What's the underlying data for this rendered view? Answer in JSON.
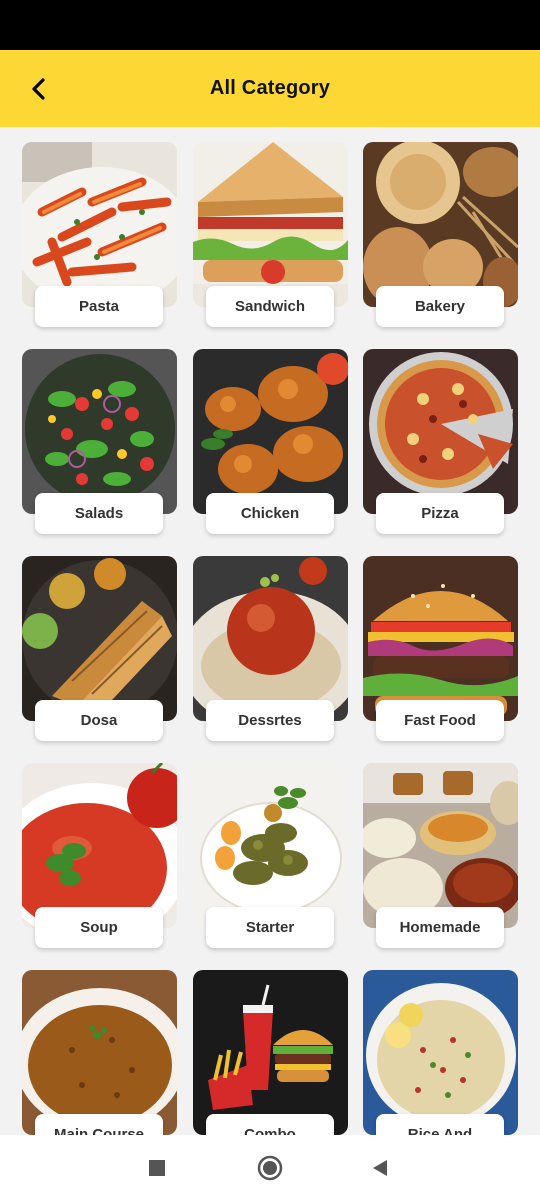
{
  "header": {
    "title": "All Category",
    "back_icon": "arrow-left-icon",
    "bg_color": "#fdd835"
  },
  "categories": [
    {
      "label": "Pasta"
    },
    {
      "label": "Sandwich"
    },
    {
      "label": "Bakery"
    },
    {
      "label": "Salads"
    },
    {
      "label": "Chicken"
    },
    {
      "label": "Pizza"
    },
    {
      "label": "Dosa"
    },
    {
      "label": "Dessrtes"
    },
    {
      "label": "Fast Food"
    },
    {
      "label": "Soup"
    },
    {
      "label": "Starter"
    },
    {
      "label": "Homemade"
    },
    {
      "label": "Main Course"
    },
    {
      "label": "Combo"
    },
    {
      "label": "Rice And"
    }
  ],
  "navbar": {
    "recents_icon": "square-icon",
    "home_icon": "circle-icon",
    "back_icon": "triangle-back-icon"
  }
}
